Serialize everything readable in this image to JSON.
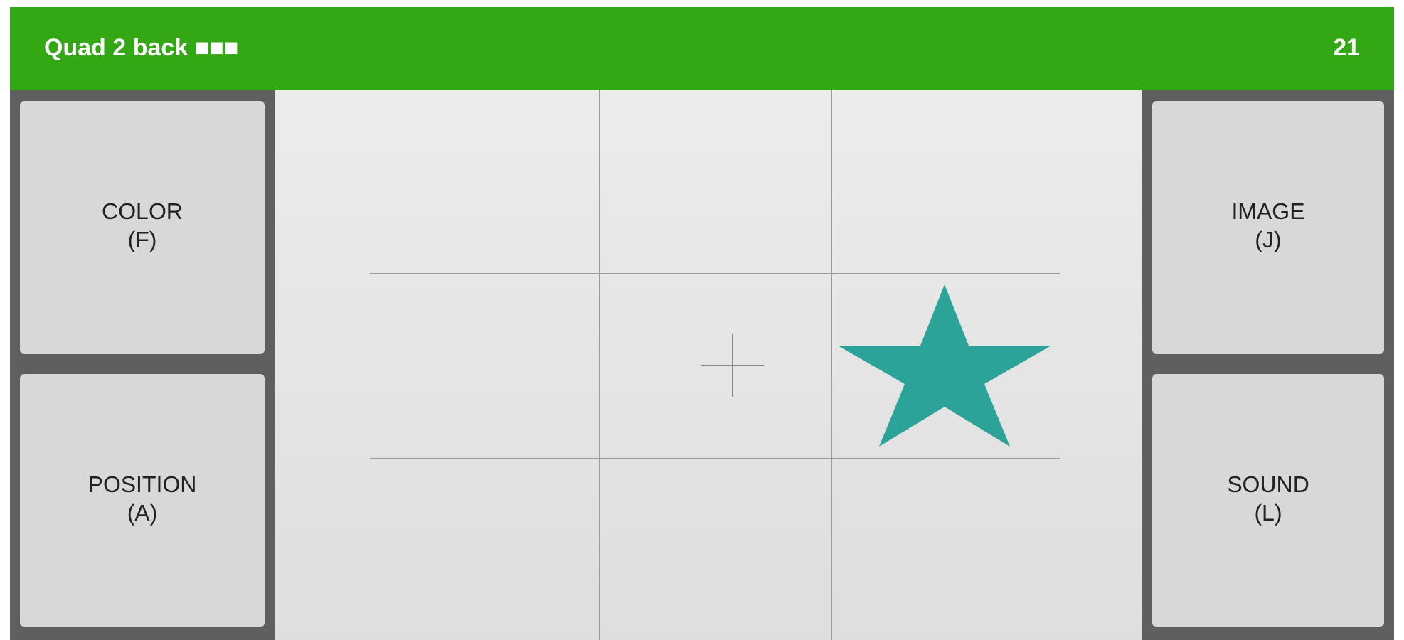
{
  "header": {
    "title": "Quad 2 back ■■■",
    "score": "21"
  },
  "left_buttons": [
    {
      "label": "COLOR",
      "key": "(F)"
    },
    {
      "label": "POSITION",
      "key": "(A)"
    }
  ],
  "right_buttons": [
    {
      "label": "IMAGE",
      "key": "(J)"
    },
    {
      "label": "SOUND",
      "key": "(L)"
    }
  ],
  "grid_cells": [
    {
      "kind": "empty"
    },
    {
      "kind": "empty"
    },
    {
      "kind": "empty"
    },
    {
      "kind": "empty"
    },
    {
      "kind": "crosshair"
    },
    {
      "kind": "star"
    },
    {
      "kind": "empty"
    },
    {
      "kind": "empty"
    },
    {
      "kind": "empty"
    }
  ]
}
